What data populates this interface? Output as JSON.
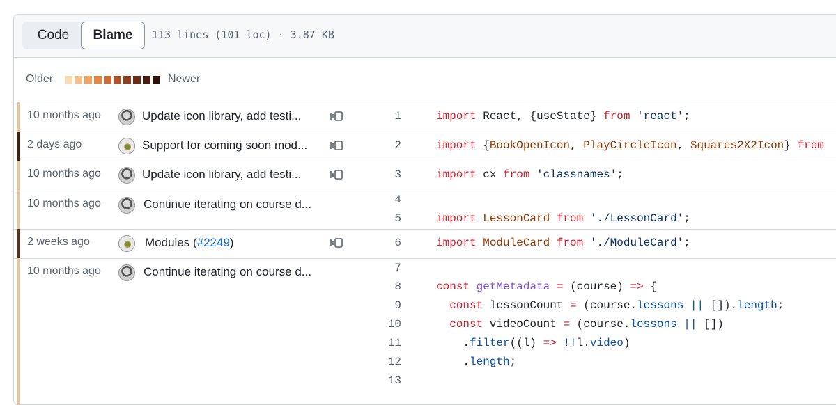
{
  "header": {
    "tabs": [
      {
        "label": "Code"
      },
      {
        "label": "Blame"
      }
    ],
    "active_tab": "Blame",
    "file_info": "113 lines (101 loc) · 3.87 KB"
  },
  "legend": {
    "older": "Older",
    "newer": "Newer",
    "colors": [
      "#f7dcb4",
      "#f2c08a",
      "#eea263",
      "#e48745",
      "#cc6c36",
      "#b0532a",
      "#8e3d1f",
      "#6b2a14",
      "#4a1c0d",
      "#2d1006"
    ]
  },
  "blame_rows": [
    {
      "when": "10 months ago",
      "message": "Update icon library, add testi...",
      "color": "#f2c08a"
    },
    {
      "when": "2 days ago",
      "message": "Support for coming soon mod...",
      "color": "#4a1c0d"
    },
    {
      "when": "10 months ago",
      "message": "Update icon library, add testi...",
      "color": "#f2c08a"
    },
    {
      "when": "10 months ago",
      "message": "Continue iterating on course d...",
      "color": "#f2c08a"
    },
    {
      "when": "2 weeks ago",
      "message_prefix": "Modules (",
      "message_link": "#2249",
      "message_suffix": ")",
      "color": "#6b2a14"
    },
    {
      "when": "10 months ago",
      "message": "Continue iterating on course d...",
      "color": "#f2c08a"
    }
  ],
  "line_numbers": [
    "1",
    "2",
    "3",
    "4",
    "5",
    "6",
    "7",
    "8",
    "9",
    "10",
    "11",
    "12",
    "13"
  ],
  "code": {
    "l1": {
      "a": "import",
      "b": " React, {useState} ",
      "c": "from",
      "d": " ",
      "e": "'react'",
      "f": ";"
    },
    "l2": {
      "a": "import",
      "b": " {",
      "c": "BookOpenIcon",
      "d": ", ",
      "e": "PlayCircleIcon",
      "f": ", ",
      "g": "Squares2X2Icon",
      "h": "} ",
      "i": "from"
    },
    "l3": {
      "a": "import",
      "b": " cx ",
      "c": "from",
      "d": " ",
      "e": "'classnames'",
      "f": ";"
    },
    "l5": {
      "a": "import",
      "b": " ",
      "c": "LessonCard",
      "d": " ",
      "e": "from",
      "f": " ",
      "g": "'./LessonCard'",
      "h": ";"
    },
    "l6": {
      "a": "import",
      "b": " ",
      "c": "ModuleCard",
      "d": " ",
      "e": "from",
      "f": " ",
      "g": "'./ModuleCard'",
      "h": ";"
    },
    "l8": {
      "a": "const",
      "b": " ",
      "c": "getMetadata",
      "d": " ",
      "e": "=",
      "f": " (course) ",
      "g": "=>",
      "h": " {"
    },
    "l9": {
      "a": "  ",
      "b": "const",
      "c": " lessonCount ",
      "d": "=",
      "e": " (course.",
      "f": "lessons",
      "g": " ",
      "h": "||",
      "i": " []).",
      "j": "length",
      "k": ";"
    },
    "l10": {
      "a": "  ",
      "b": "const",
      "c": " videoCount ",
      "d": "=",
      "e": " (course.",
      "f": "lessons",
      "g": " ",
      "h": "||",
      "i": " [])"
    },
    "l11": {
      "a": "    .",
      "b": "filter",
      "c": "((l) ",
      "d": "=>",
      "e": " ",
      "f": "!!",
      "g": "l.",
      "h": "video",
      "i": ")"
    },
    "l12": {
      "a": "    .",
      "b": "length",
      "c": ";"
    }
  }
}
